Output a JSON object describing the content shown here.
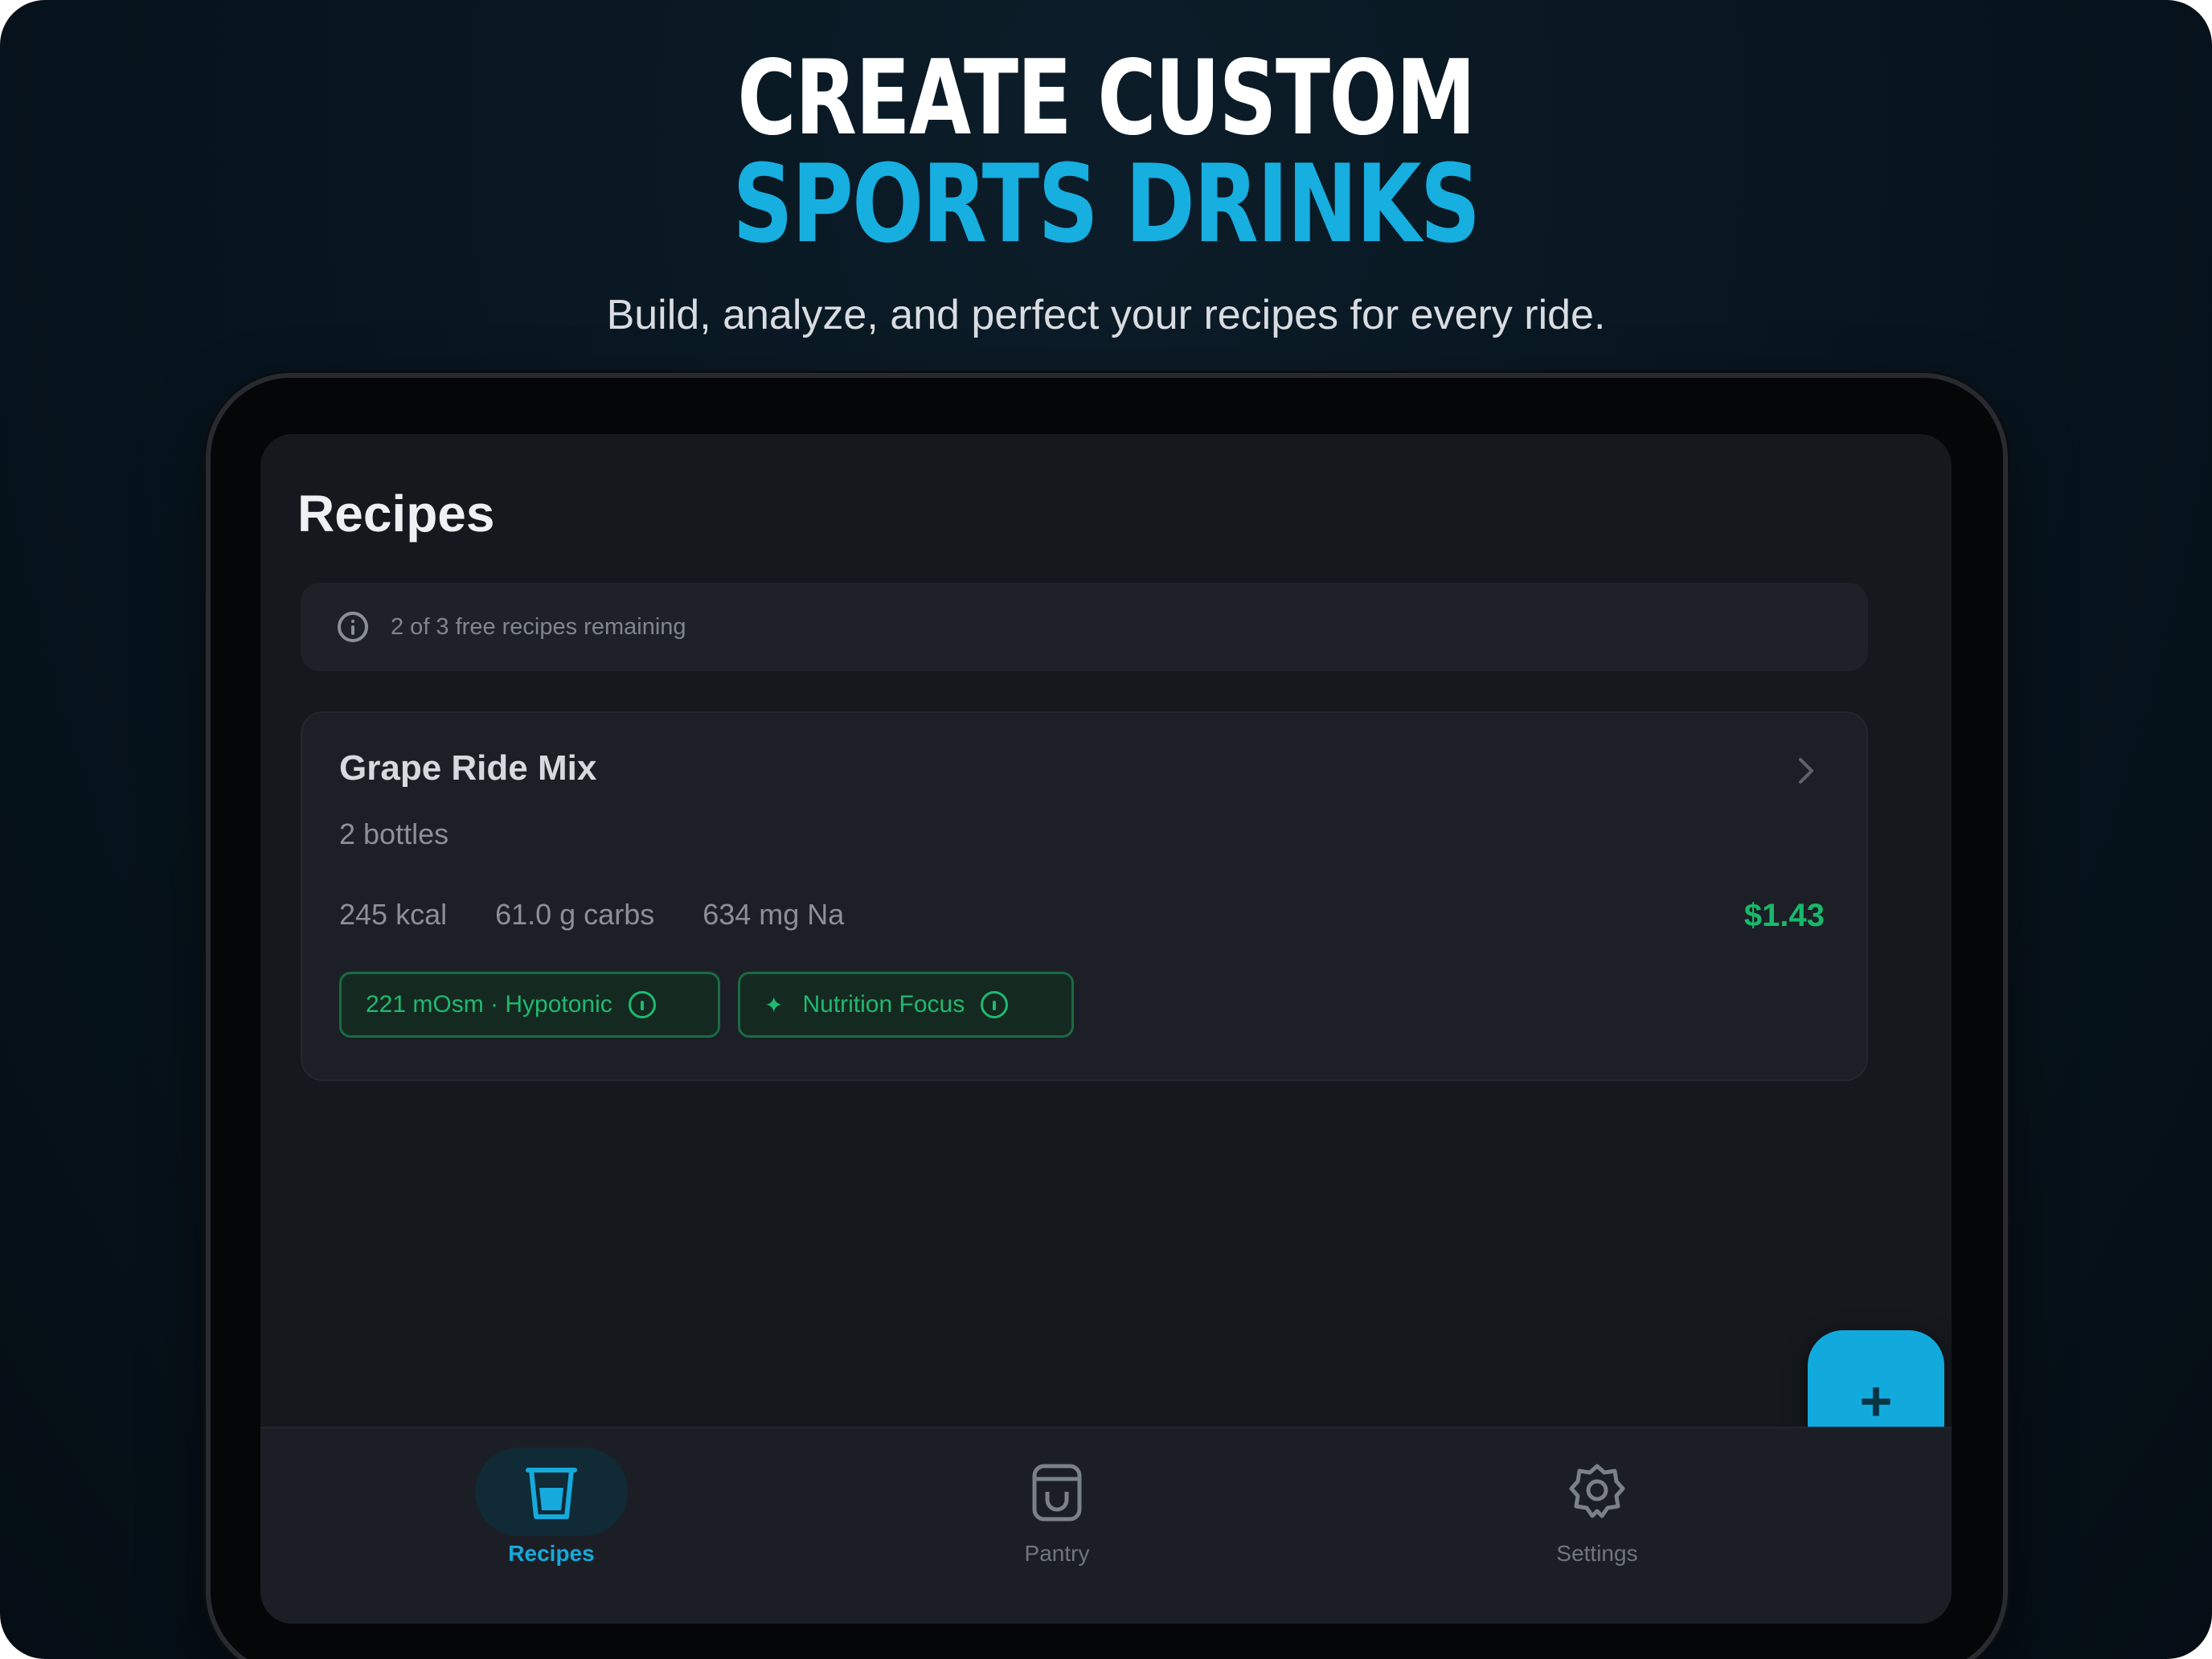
{
  "promo": {
    "headline_line1": "CREATE CUSTOM",
    "headline_line2": "SPORTS DRINKS",
    "tagline": "Build, analyze, and perfect your recipes for every ride."
  },
  "screen": {
    "title": "Recipes",
    "banner_text": "2 of 3 free recipes remaining",
    "recipe": {
      "name": "Grape Ride Mix",
      "bottles": "2 bottles",
      "kcal": "245 kcal",
      "carbs": "61.0 g carbs",
      "sodium": "634 mg Na",
      "price": "$1.43",
      "chips": [
        {
          "label": "221 mOsm · Hypotonic",
          "icon": "info-icon"
        },
        {
          "label": "Nutrition Focus",
          "icon": "sparkle-icon"
        }
      ]
    },
    "fab_label": "+",
    "tabs": [
      {
        "label": "Recipes",
        "icon": "cup-icon",
        "active": true
      },
      {
        "label": "Pantry",
        "icon": "pantry-jar-icon",
        "active": false
      },
      {
        "label": "Settings",
        "icon": "gear-icon",
        "active": false
      }
    ]
  },
  "colors": {
    "accent": "#17aee0",
    "success": "#19b86b",
    "background": "#081620",
    "screen": "#15181d"
  }
}
